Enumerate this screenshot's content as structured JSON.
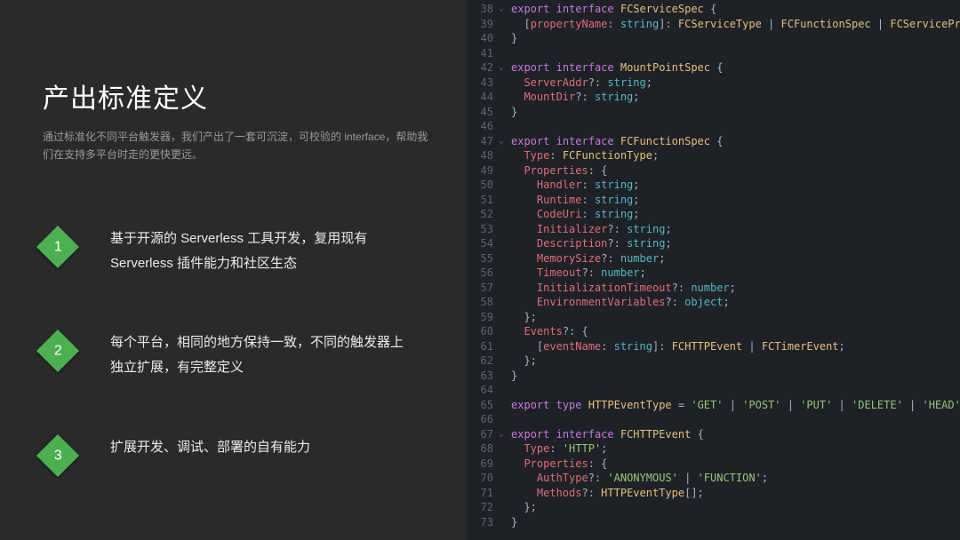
{
  "slide": {
    "title": "产出标准定义",
    "subtitle": "通过标准化不同平台触发器，我们产出了一套可沉淀，可校验的 interface，帮助我们在支持多平台时走的更快更远。",
    "bullets": [
      {
        "num": "1",
        "text": "基于开源的 Serverless 工具开发，复用现有 Serverless 插件能力和社区生态"
      },
      {
        "num": "2",
        "text": "每个平台，相同的地方保持一致，不同的触发器上独立扩展，有完整定义"
      },
      {
        "num": "3",
        "text": "扩展开发、调试、部署的自有能力"
      }
    ]
  },
  "code": {
    "start": 38,
    "lines": [
      {
        "f": "v",
        "t": [
          [
            "kw",
            "export"
          ],
          [
            "pn",
            " "
          ],
          [
            "kw",
            "interface"
          ],
          [
            "pn",
            " "
          ],
          [
            "ty",
            "FCServiceSpec"
          ],
          [
            "pn",
            " {"
          ]
        ]
      },
      {
        "f": "",
        "t": [
          [
            "pn",
            "  ["
          ],
          [
            "prop",
            "propertyName"
          ],
          [
            "pn",
            ": "
          ],
          [
            "prim",
            "string"
          ],
          [
            "pn",
            "]: "
          ],
          [
            "ty",
            "FCServiceType"
          ],
          [
            "pn",
            " | "
          ],
          [
            "ty",
            "FCFunctionSpec"
          ],
          [
            "pn",
            " | "
          ],
          [
            "ty",
            "FCServicePrope"
          ]
        ]
      },
      {
        "f": "",
        "t": [
          [
            "pn",
            "}"
          ]
        ]
      },
      {
        "f": "",
        "t": []
      },
      {
        "f": "v",
        "t": [
          [
            "kw",
            "export"
          ],
          [
            "pn",
            " "
          ],
          [
            "kw",
            "interface"
          ],
          [
            "pn",
            " "
          ],
          [
            "ty",
            "MountPointSpec"
          ],
          [
            "pn",
            " {"
          ]
        ]
      },
      {
        "f": "",
        "t": [
          [
            "pn",
            "  "
          ],
          [
            "prop",
            "ServerAddr"
          ],
          [
            "pn",
            "?: "
          ],
          [
            "prim",
            "string"
          ],
          [
            "pn",
            ";"
          ]
        ]
      },
      {
        "f": "",
        "t": [
          [
            "pn",
            "  "
          ],
          [
            "prop",
            "MountDir"
          ],
          [
            "pn",
            "?: "
          ],
          [
            "prim",
            "string"
          ],
          [
            "pn",
            ";"
          ]
        ]
      },
      {
        "f": "",
        "t": [
          [
            "pn",
            "}"
          ]
        ]
      },
      {
        "f": "",
        "t": []
      },
      {
        "f": "v",
        "t": [
          [
            "kw",
            "export"
          ],
          [
            "pn",
            " "
          ],
          [
            "kw",
            "interface"
          ],
          [
            "pn",
            " "
          ],
          [
            "ty",
            "FCFunctionSpec"
          ],
          [
            "pn",
            " {"
          ]
        ]
      },
      {
        "f": "",
        "t": [
          [
            "pn",
            "  "
          ],
          [
            "prop",
            "Type"
          ],
          [
            "pn",
            ": "
          ],
          [
            "ty",
            "FCFunctionType"
          ],
          [
            "pn",
            ";"
          ]
        ]
      },
      {
        "f": "",
        "t": [
          [
            "pn",
            "  "
          ],
          [
            "prop",
            "Properties"
          ],
          [
            "pn",
            ": {"
          ]
        ]
      },
      {
        "f": "",
        "t": [
          [
            "pn",
            "    "
          ],
          [
            "prop",
            "Handler"
          ],
          [
            "pn",
            ": "
          ],
          [
            "prim",
            "string"
          ],
          [
            "pn",
            ";"
          ]
        ]
      },
      {
        "f": "",
        "t": [
          [
            "pn",
            "    "
          ],
          [
            "prop",
            "Runtime"
          ],
          [
            "pn",
            ": "
          ],
          [
            "prim",
            "string"
          ],
          [
            "pn",
            ";"
          ]
        ]
      },
      {
        "f": "",
        "t": [
          [
            "pn",
            "    "
          ],
          [
            "prop",
            "CodeUri"
          ],
          [
            "pn",
            ": "
          ],
          [
            "prim",
            "string"
          ],
          [
            "pn",
            ";"
          ]
        ]
      },
      {
        "f": "",
        "t": [
          [
            "pn",
            "    "
          ],
          [
            "prop",
            "Initializer"
          ],
          [
            "pn",
            "?: "
          ],
          [
            "prim",
            "string"
          ],
          [
            "pn",
            ";"
          ]
        ]
      },
      {
        "f": "",
        "t": [
          [
            "pn",
            "    "
          ],
          [
            "prop",
            "Description"
          ],
          [
            "pn",
            "?: "
          ],
          [
            "prim",
            "string"
          ],
          [
            "pn",
            ";"
          ]
        ]
      },
      {
        "f": "",
        "t": [
          [
            "pn",
            "    "
          ],
          [
            "prop",
            "MemorySize"
          ],
          [
            "pn",
            "?: "
          ],
          [
            "prim",
            "number"
          ],
          [
            "pn",
            ";"
          ]
        ]
      },
      {
        "f": "",
        "t": [
          [
            "pn",
            "    "
          ],
          [
            "prop",
            "Timeout"
          ],
          [
            "pn",
            "?: "
          ],
          [
            "prim",
            "number"
          ],
          [
            "pn",
            ";"
          ]
        ]
      },
      {
        "f": "",
        "t": [
          [
            "pn",
            "    "
          ],
          [
            "prop",
            "InitializationTimeout"
          ],
          [
            "pn",
            "?: "
          ],
          [
            "prim",
            "number"
          ],
          [
            "pn",
            ";"
          ]
        ]
      },
      {
        "f": "",
        "t": [
          [
            "pn",
            "    "
          ],
          [
            "prop",
            "EnvironmentVariables"
          ],
          [
            "pn",
            "?: "
          ],
          [
            "prim",
            "object"
          ],
          [
            "pn",
            ";"
          ]
        ]
      },
      {
        "f": "",
        "t": [
          [
            "pn",
            "  };"
          ]
        ]
      },
      {
        "f": "",
        "t": [
          [
            "pn",
            "  "
          ],
          [
            "prop",
            "Events"
          ],
          [
            "pn",
            "?: {"
          ]
        ]
      },
      {
        "f": "",
        "t": [
          [
            "pn",
            "    ["
          ],
          [
            "prop",
            "eventName"
          ],
          [
            "pn",
            ": "
          ],
          [
            "prim",
            "string"
          ],
          [
            "pn",
            "]: "
          ],
          [
            "ty",
            "FCHTTPEvent"
          ],
          [
            "pn",
            " | "
          ],
          [
            "ty",
            "FCTimerEvent"
          ],
          [
            "pn",
            ";"
          ]
        ]
      },
      {
        "f": "",
        "t": [
          [
            "pn",
            "  };"
          ]
        ]
      },
      {
        "f": "",
        "t": [
          [
            "pn",
            "}"
          ]
        ]
      },
      {
        "f": "",
        "t": []
      },
      {
        "f": "",
        "t": [
          [
            "kw",
            "export"
          ],
          [
            "pn",
            " "
          ],
          [
            "kw",
            "type"
          ],
          [
            "pn",
            " "
          ],
          [
            "ty",
            "HTTPEventType"
          ],
          [
            "pn",
            " = "
          ],
          [
            "str",
            "'GET'"
          ],
          [
            "pn",
            " | "
          ],
          [
            "str",
            "'POST'"
          ],
          [
            "pn",
            " | "
          ],
          [
            "str",
            "'PUT'"
          ],
          [
            "pn",
            " | "
          ],
          [
            "str",
            "'DELETE'"
          ],
          [
            "pn",
            " | "
          ],
          [
            "str",
            "'HEAD'"
          ],
          [
            "pn",
            ";"
          ]
        ]
      },
      {
        "f": "",
        "t": []
      },
      {
        "f": "v",
        "t": [
          [
            "kw",
            "export"
          ],
          [
            "pn",
            " "
          ],
          [
            "kw",
            "interface"
          ],
          [
            "pn",
            " "
          ],
          [
            "ty",
            "FCHTTPEvent"
          ],
          [
            "pn",
            " {"
          ]
        ]
      },
      {
        "f": "",
        "t": [
          [
            "pn",
            "  "
          ],
          [
            "prop",
            "Type"
          ],
          [
            "pn",
            ": "
          ],
          [
            "str",
            "'HTTP'"
          ],
          [
            "pn",
            ";"
          ]
        ]
      },
      {
        "f": "",
        "t": [
          [
            "pn",
            "  "
          ],
          [
            "prop",
            "Properties"
          ],
          [
            "pn",
            ": {"
          ]
        ]
      },
      {
        "f": "",
        "t": [
          [
            "pn",
            "    "
          ],
          [
            "prop",
            "AuthType"
          ],
          [
            "pn",
            "?: "
          ],
          [
            "str",
            "'ANONYMOUS'"
          ],
          [
            "pn",
            " | "
          ],
          [
            "str",
            "'FUNCTION'"
          ],
          [
            "pn",
            ";"
          ]
        ]
      },
      {
        "f": "",
        "t": [
          [
            "pn",
            "    "
          ],
          [
            "prop",
            "Methods"
          ],
          [
            "pn",
            "?: "
          ],
          [
            "ty",
            "HTTPEventType"
          ],
          [
            "pn",
            "[];"
          ]
        ]
      },
      {
        "f": "",
        "t": [
          [
            "pn",
            "  };"
          ]
        ]
      },
      {
        "f": "",
        "t": [
          [
            "pn",
            "}"
          ]
        ]
      }
    ]
  }
}
